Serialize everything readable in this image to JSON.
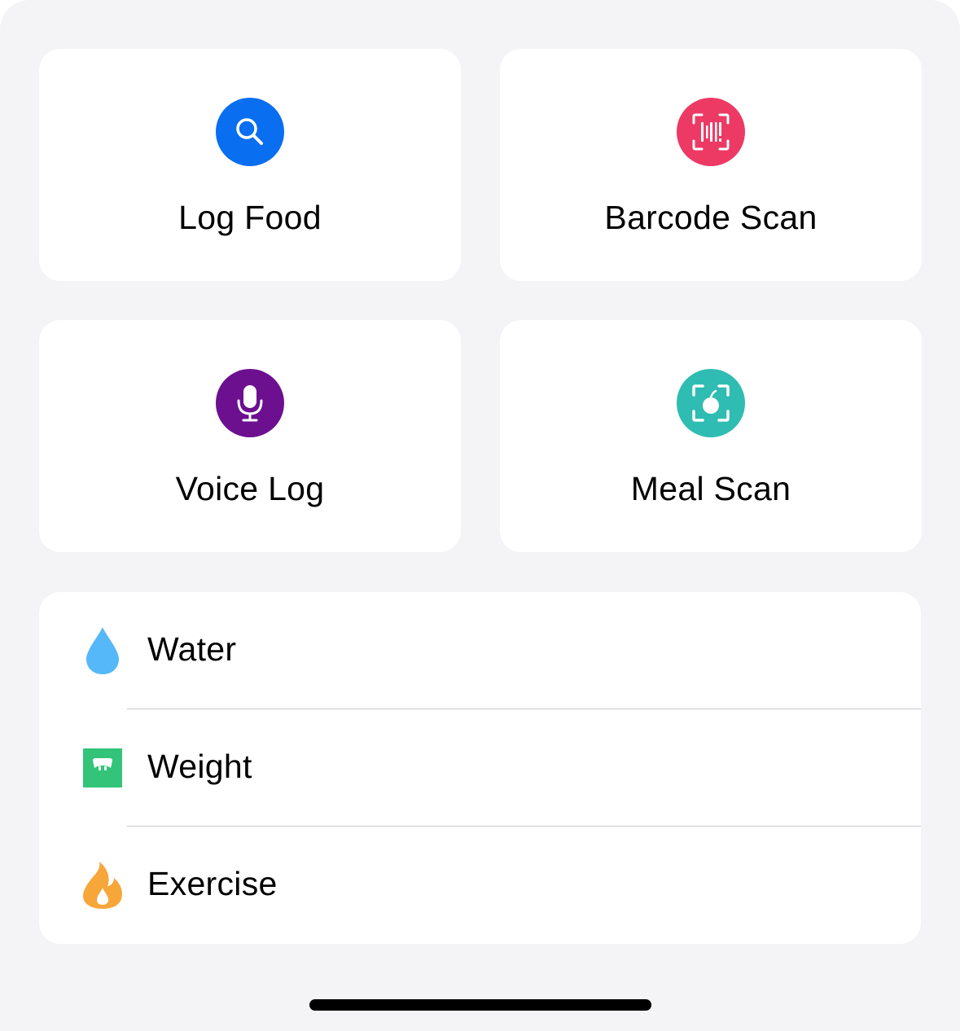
{
  "quick_actions": [
    {
      "label": "Log Food",
      "icon": "search-icon",
      "color": "#0a6ef0"
    },
    {
      "label": "Barcode Scan",
      "icon": "barcode-icon",
      "color": "#ec3a65"
    },
    {
      "label": "Voice Log",
      "icon": "microphone-icon",
      "color": "#6c1090"
    },
    {
      "label": "Meal Scan",
      "icon": "meal-scan-icon",
      "color": "#2fbcb2"
    }
  ],
  "list": [
    {
      "label": "Water",
      "icon": "water-drop-icon",
      "color": "#55b8f8"
    },
    {
      "label": "Weight",
      "icon": "scale-icon",
      "color": "#33c47a"
    },
    {
      "label": "Exercise",
      "icon": "flame-icon",
      "color": "#f7a63a"
    }
  ]
}
